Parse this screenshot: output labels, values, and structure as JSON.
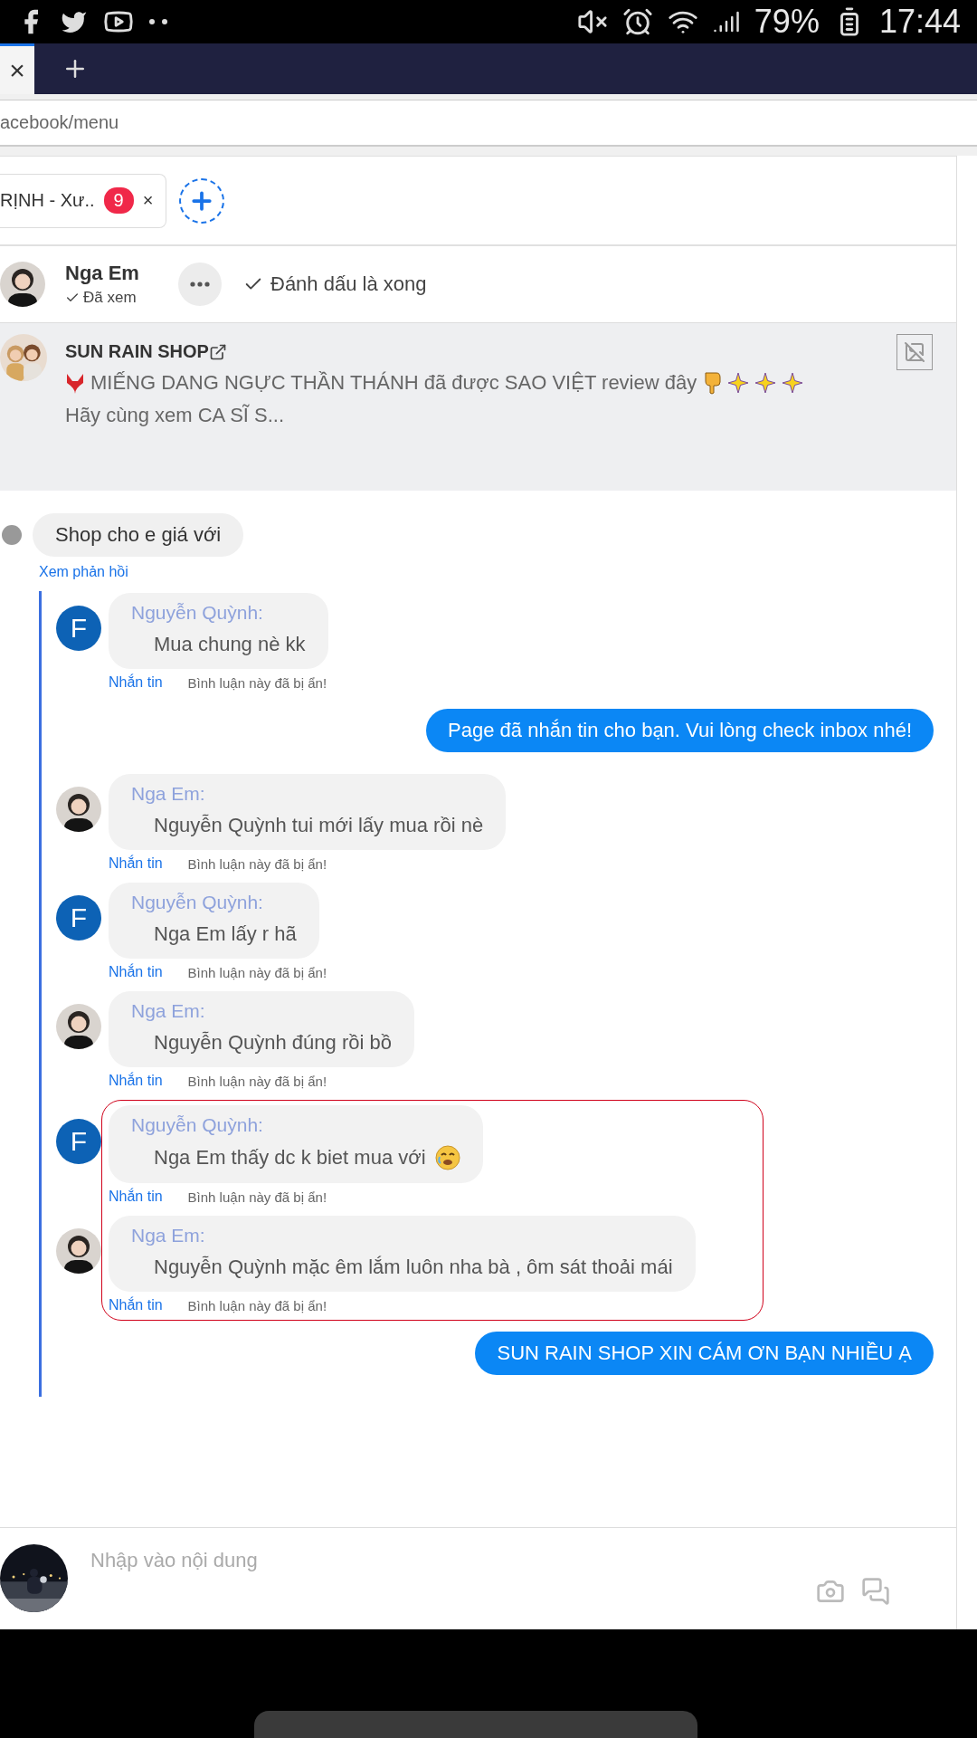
{
  "status_bar": {
    "battery": "79%",
    "time": "17:44"
  },
  "browser": {
    "tab_close": "×",
    "address": "acebook/menu"
  },
  "conversation_tabs": [
    {
      "label": "RỊNH - Xư..",
      "badge": "9",
      "close": "×",
      "selected": true
    }
  ],
  "header": {
    "name": "Nga Em",
    "seen": "Đã xem",
    "mark_done": "Đánh dấu là xong"
  },
  "post": {
    "page": "SUN RAIN SHOP",
    "text": "MIẾNG DANG NGỰC THẦN THÁNH đã được SAO VIỆT review đây",
    "text_2": "Hãy cùng xem CA SĨ S..."
  },
  "comment": {
    "text": "Shop cho e giá với",
    "view_replies": "Xem phản hồi"
  },
  "replies": [
    {
      "kind": "comment",
      "initial": "F",
      "author": "Nguyễn Quỳnh:",
      "text": "Mua chung nè kk",
      "emoji": false,
      "message_link": "Nhắn tin",
      "status": "Bình luận này đã bị ẩn!",
      "highlighted": false
    },
    {
      "kind": "page_reply",
      "text": "Page đã nhắn tin cho bạn. Vui lòng check inbox nhé!"
    },
    {
      "kind": "comment",
      "author": "Nga Em:",
      "text": "Nguyễn Quỳnh tui mới lấy mua rồi nè",
      "emoji": false,
      "message_link": "Nhắn tin",
      "status": "Bình luận này đã bị ẩn!",
      "highlighted": false
    },
    {
      "kind": "comment",
      "initial": "F",
      "author": "Nguyễn Quỳnh:",
      "text": "Nga Em lấy r hã",
      "emoji": false,
      "message_link": "Nhắn tin",
      "status": "Bình luận này đã bị ẩn!",
      "highlighted": false
    },
    {
      "kind": "comment",
      "author": "Nga Em:",
      "text": "Nguyễn Quỳnh đúng rồi bồ",
      "emoji": false,
      "message_link": "Nhắn tin",
      "status": "Bình luận này đã bị ẩn!",
      "highlighted": false
    },
    {
      "kind": "comment",
      "initial": "F",
      "author": "Nguyễn Quỳnh:",
      "text": "Nga Em thấy dc k biet mua với",
      "emoji": true,
      "message_link": "Nhắn tin",
      "status": "Bình luận này đã bị ẩn!",
      "highlighted": true
    },
    {
      "kind": "comment",
      "author": "Nga Em:",
      "text": "Nguyễn Quỳnh mặc êm lắm luôn nha bà , ôm sát thoải mái",
      "emoji": false,
      "message_link": "Nhắn tin",
      "status": "Bình luận này đã bị ẩn!",
      "highlighted": true
    },
    {
      "kind": "page_reply",
      "text": "SUN RAIN SHOP XIN CÁM ƠN BẠN NHIỀU Ạ"
    }
  ],
  "composer": {
    "placeholder": "Nhập vào nội dung"
  }
}
